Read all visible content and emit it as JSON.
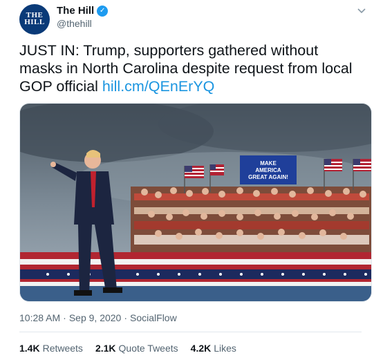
{
  "author": {
    "avatar_line1": "THE",
    "avatar_line2": "HILL",
    "display_name": "The Hill",
    "handle": "@thehill",
    "verified": true
  },
  "tweet": {
    "text": "JUST IN: Trump, supporters gathered without masks in North Carolina despite request from local GOP official ",
    "link": "hill.cm/QEnErYQ"
  },
  "media": {
    "sign_line1": "MAKE",
    "sign_line2": "AMERICA",
    "sign_line3": "GREAT AGAIN!"
  },
  "meta": {
    "time": "10:28 AM",
    "separator1": "·",
    "date": "Sep 9, 2020",
    "separator2": "·",
    "source": "SocialFlow"
  },
  "stats": [
    {
      "count": "1.4K",
      "label": "Retweets"
    },
    {
      "count": "2.1K",
      "label": "Quote Tweets"
    },
    {
      "count": "4.2K",
      "label": "Likes"
    }
  ],
  "colors": {
    "link": "#1b95e0",
    "verified": "#1d9bf0",
    "brand_avatar": "#0a3a78",
    "secondary_text": "#536471"
  },
  "icons": {
    "more": "chevron-down-icon",
    "verified": "verified-badge-icon"
  }
}
